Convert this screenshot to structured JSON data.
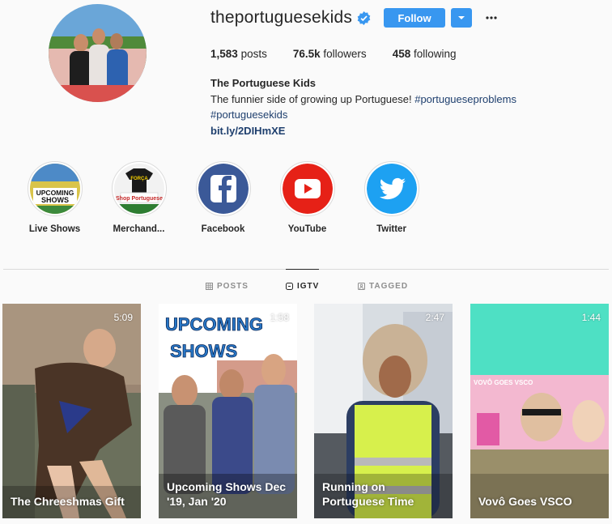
{
  "profile": {
    "username": "theportuguesekids",
    "follow_label": "Follow",
    "stats": {
      "posts_count": "1,583",
      "posts_label": "posts",
      "followers_count": "76.5k",
      "followers_label": "followers",
      "following_count": "458",
      "following_label": "following"
    },
    "bio": {
      "name": "The Portuguese Kids",
      "text": "The funnier side of growing up Portuguese! ",
      "hashtag1": "#portugueseproblems",
      "hashtag2": "#portuguesekids",
      "link": "bit.ly/2DIHmXE"
    }
  },
  "highlights": [
    {
      "label": "Live Shows",
      "icon": "upcoming-shows-thumbnail",
      "art_text_1": "UPCOMING",
      "art_text_2": "SHOWS"
    },
    {
      "label": "Merchand...",
      "icon": "shop-portuguese-thumbnail",
      "art_text_1": "FORÇA",
      "art_text_2": "Shop Portuguese"
    },
    {
      "label": "Facebook",
      "icon": "facebook-icon"
    },
    {
      "label": "YouTube",
      "icon": "youtube-icon"
    },
    {
      "label": "Twitter",
      "icon": "twitter-icon"
    }
  ],
  "tabs": [
    {
      "label": "POSTS",
      "icon": "grid-icon",
      "active": false
    },
    {
      "label": "IGTV",
      "icon": "igtv-icon",
      "active": true
    },
    {
      "label": "TAGGED",
      "icon": "tagged-icon",
      "active": false
    }
  ],
  "videos": [
    {
      "title": "The Chreeshmas Gift",
      "duration": "5:09"
    },
    {
      "title": "Upcoming Shows Dec '19, Jan '20",
      "duration": "1:58",
      "art_text_1": "UPCOMING",
      "art_text_2": "SHOWS"
    },
    {
      "title": "Running on Portuguese Time",
      "duration": "2:47"
    },
    {
      "title": "Vovô Goes VSCO",
      "duration": "1:44",
      "art_text": "VOVÔ GOES VSCO"
    }
  ],
  "colors": {
    "accent": "#3897f0",
    "link": "#1e3f6e",
    "facebook": "#3b5998",
    "youtube": "#e62117",
    "twitter": "#1da1f2"
  }
}
